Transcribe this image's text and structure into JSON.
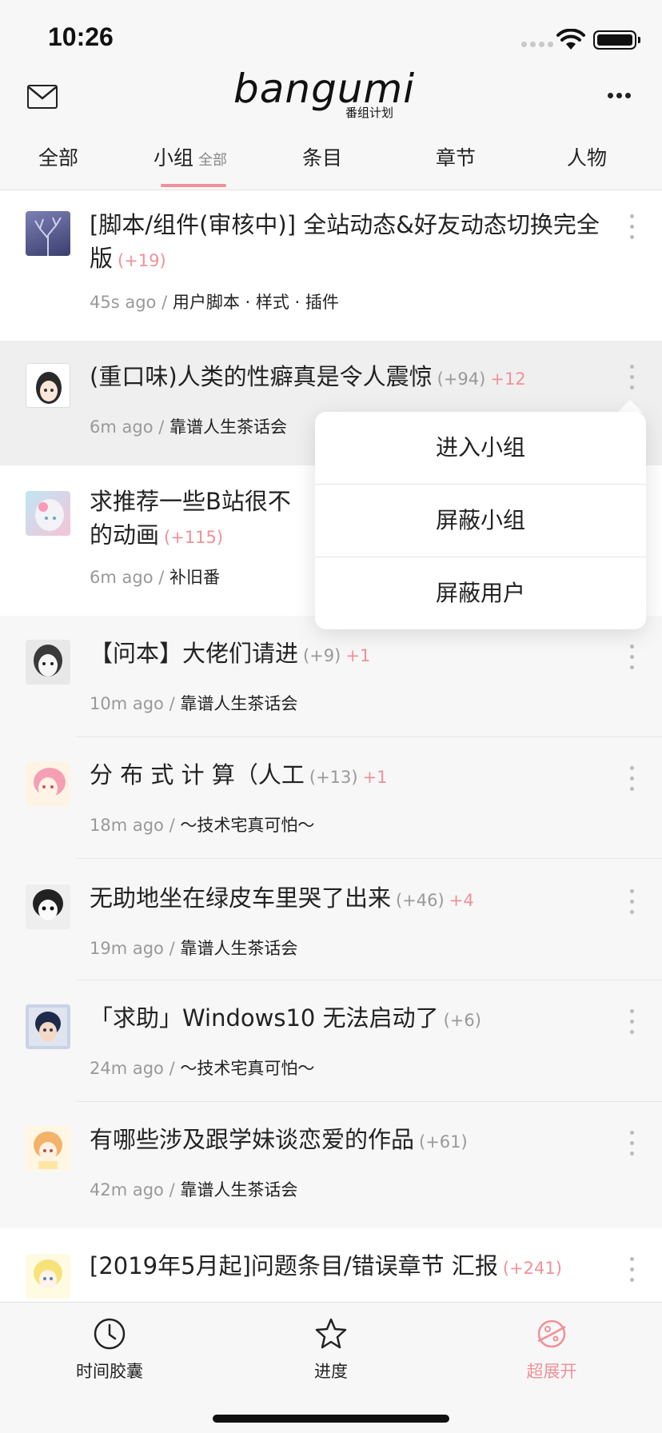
{
  "status": {
    "time": "10:26"
  },
  "header": {
    "logo": "bangumi",
    "logo_sub": "番组计划"
  },
  "tabs": [
    {
      "label": "全部"
    },
    {
      "label": "小组",
      "sub": "全部",
      "active": true
    },
    {
      "label": "条目"
    },
    {
      "label": "章节"
    },
    {
      "label": "人物"
    }
  ],
  "items": [
    {
      "title": "[脚本/组件(审核中)] 全站动态&好友动态切换完全版",
      "count": "(+19)",
      "count_style": "pink",
      "extra": "",
      "time": "45s ago",
      "group": "用户脚本 · 样式 · 插件"
    },
    {
      "title": "(重口味)人类的性癖真是令人震惊",
      "count": "(+94)",
      "extra": "+12",
      "time": "6m ago",
      "group": "靠谱人生茶话会"
    },
    {
      "title": "求推荐一些B站很不",
      "title2": "的动画",
      "count": "(+115)",
      "count_style": "pink",
      "extra": "",
      "time": "6m ago",
      "group": "补旧番"
    },
    {
      "title": "【问本】大佬们请进",
      "count": "(+9)",
      "extra": "+1",
      "time": "10m ago",
      "group": "靠谱人生茶话会"
    },
    {
      "title": "分 布 式 计 算（人工",
      "count": "(+13)",
      "extra": "+1",
      "time": "18m ago",
      "group": "～技术宅真可怕～"
    },
    {
      "title": "无助地坐在绿皮车里哭了出来",
      "count": "(+46)",
      "extra": "+4",
      "time": "19m ago",
      "group": "靠谱人生茶话会"
    },
    {
      "title": "「求助」Windows10 无法启动了",
      "count": "(+6)",
      "extra": "",
      "time": "24m ago",
      "group": "～技术宅真可怕～"
    },
    {
      "title": "有哪些涉及跟学妹谈恋爱的作品",
      "count": "(+61)",
      "extra": "",
      "time": "42m ago",
      "group": "靠谱人生茶话会"
    },
    {
      "title": "[2019年5月起]问题条目/错误章节 汇报",
      "count": "(+241)",
      "count_style": "pink",
      "extra": "",
      "time": "",
      "group": ""
    }
  ],
  "popup": {
    "items": [
      "进入小组",
      "屏蔽小组",
      "屏蔽用户"
    ]
  },
  "tabbar": [
    {
      "label": "时间胶囊",
      "icon": "clock-icon"
    },
    {
      "label": "进度",
      "icon": "star-icon"
    },
    {
      "label": "超展开",
      "icon": "planet-icon",
      "active": true
    }
  ],
  "colors": {
    "accent": "#f09199",
    "text": "#222222",
    "muted": "#999999"
  }
}
